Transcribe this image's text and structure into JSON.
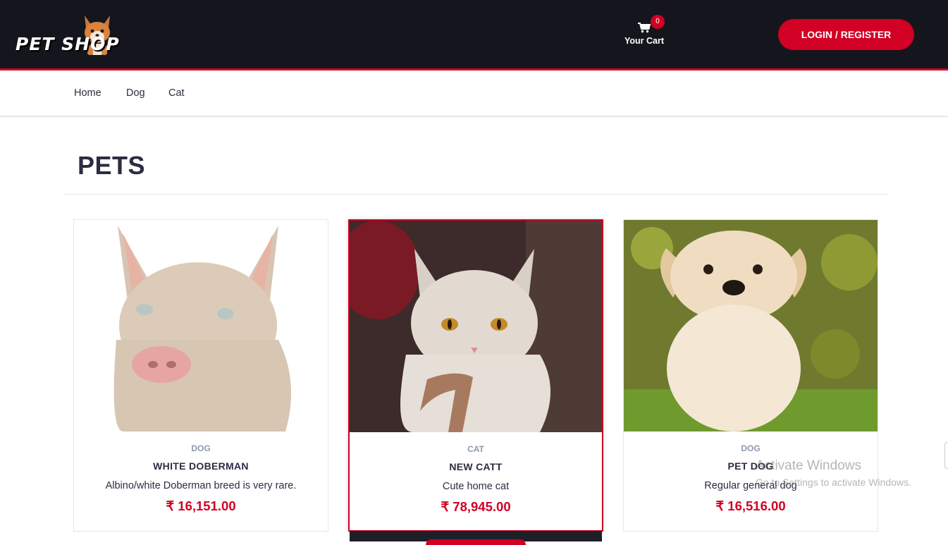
{
  "brand": {
    "logo_text": "PET SHOP"
  },
  "header": {
    "cart": {
      "count": "0",
      "label": "Your Cart"
    },
    "login_label": "LOGIN / REGISTER"
  },
  "nav": {
    "items": [
      "Home",
      "Dog",
      "Cat"
    ]
  },
  "section": {
    "title": "PETS"
  },
  "products": [
    {
      "category": "DOG",
      "name": "WHITE DOBERMAN",
      "description": "Albino/white Doberman breed is very rare.",
      "price": "₹ 16,151.00"
    },
    {
      "category": "CAT",
      "name": "NEW CATT",
      "description": "Cute home cat",
      "price": "₹ 78,945.00"
    },
    {
      "category": "DOG",
      "name": "PET DOG",
      "description": "Regular general dog",
      "price": "₹ 16,516.00"
    }
  ],
  "watermark": {
    "title": "Activate Windows",
    "subtitle": "Go to Settings to activate Windows."
  },
  "colors": {
    "accent": "#d10024",
    "header_bg": "#15161d",
    "text": "#2b2d42",
    "muted": "#8d99ae"
  }
}
